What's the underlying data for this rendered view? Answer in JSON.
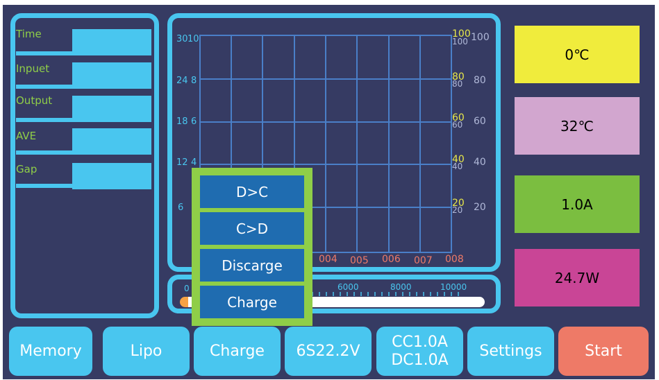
{
  "colors": {
    "background": "#363b63",
    "accent": "#49c6ef",
    "green": "#8fce48",
    "grid": "#4a7fc8",
    "yellow_axis": "#e8e84a",
    "red_tick": "#ee7a67"
  },
  "params": [
    "Time",
    "Inpuet",
    "Output",
    "AVE",
    "Gap"
  ],
  "chart": {
    "left_outer": [
      "30",
      "24",
      "18",
      "12",
      "6"
    ],
    "left_inner": [
      "10",
      "8",
      "6",
      "4"
    ],
    "right_yellow": [
      "100",
      "80",
      "60",
      "40",
      "20"
    ],
    "right_yellow_small": [
      "100",
      "80",
      "60",
      "40",
      "20"
    ],
    "right_white": [
      "100",
      "80",
      "60",
      "40",
      "20"
    ],
    "x_ticks": [
      "004",
      "005",
      "006",
      "007",
      "008"
    ]
  },
  "slider": {
    "start": "0",
    "ticks": [
      "6000",
      "8000",
      "10000"
    ]
  },
  "status": {
    "temp1": "0℃",
    "temp2": "32℃",
    "current": "1.0A",
    "power": "24.7W"
  },
  "status_colors": {
    "temp1": "#f0ec3c",
    "temp2": "#d2a6cf",
    "current": "#7bbe40",
    "power": "#c94596"
  },
  "buttons": {
    "memory": "Memory",
    "lipo": "Lipo",
    "charge": "Charge",
    "voltage": "6S22.2V",
    "cc": "CC1.0A",
    "dc": "DC1.0A",
    "settings": "Settings",
    "start": "Start"
  },
  "start_color": "#ee7a67",
  "menu": [
    "D>C",
    "C>D",
    "Discarge",
    "Charge"
  ]
}
